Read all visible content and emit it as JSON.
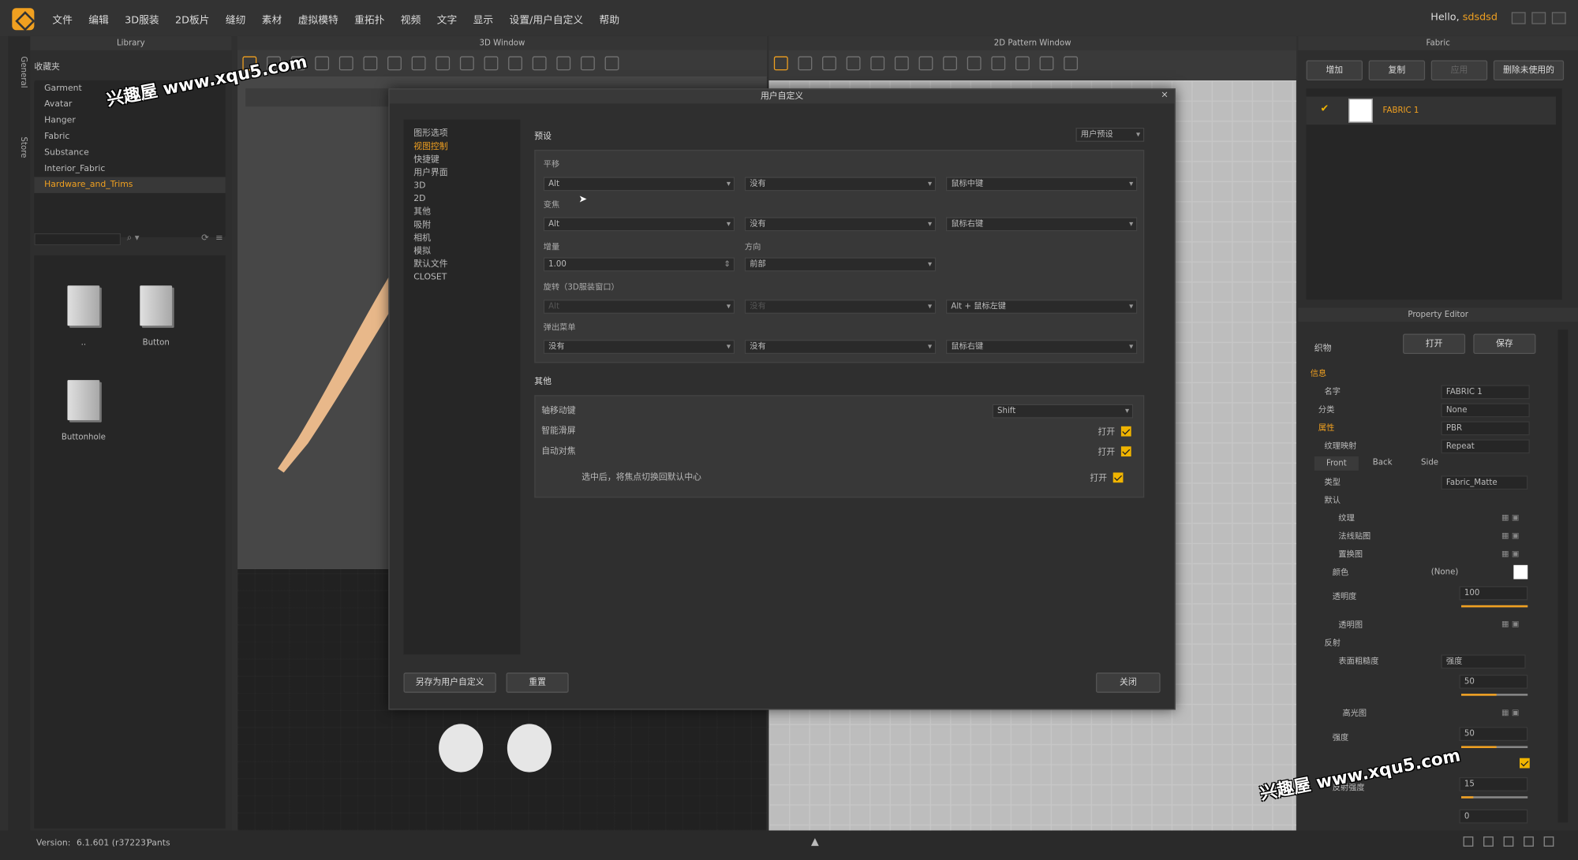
{
  "menubar": {
    "items": [
      "文件",
      "编辑",
      "3D服装",
      "2D板片",
      "缝纫",
      "素材",
      "虚拟模特",
      "重拓扑",
      "视频",
      "文字",
      "显示",
      "设置/用户自定义",
      "帮助"
    ],
    "greeting": "Hello,",
    "username": "sdsdsd"
  },
  "left_tabs": [
    "General",
    "Store"
  ],
  "library": {
    "title": "Library",
    "favorites_label": "收藏夹",
    "items": [
      "Garment",
      "Avatar",
      "Hanger",
      "Fabric",
      "Substance",
      "Interior_Fabric",
      "Hardware_and_Trims"
    ],
    "selected": "Hardware_and_Trims",
    "folders": [
      "..",
      "Button",
      "Buttonhole"
    ]
  },
  "window3d": {
    "title": "3D Window"
  },
  "window2d": {
    "title": "2D Pattern Window"
  },
  "fabric_panel": {
    "title": "Fabric",
    "buttons": [
      "增加",
      "复制",
      "应用",
      "删除未使用的"
    ],
    "fabric_name": "FABRIC 1"
  },
  "property_editor": {
    "title": "Property Editor",
    "object_label": "织物",
    "open_label": "打开",
    "save_label": "保存",
    "section_info": "信息",
    "name_label": "名字",
    "name_value": "FABRIC 1",
    "category_label": "分类",
    "category_value": "None",
    "attr_label": "属性",
    "attr_value": "PBR",
    "texture_map_label": "纹理映射",
    "texture_map_value": "Repeat",
    "sides": [
      "Front",
      "Back",
      "Side"
    ],
    "type_label": "类型",
    "type_value": "Fabric_Matte",
    "default_label": "默认",
    "texture_label": "纹理",
    "normal_label": "法线贴图",
    "displacement_label": "置换图",
    "color_label": "颜色",
    "color_value": "(None)",
    "opacity_label": "透明度",
    "opacity_value": "100",
    "opacity_map_label": "透明图",
    "reflection_label": "反射",
    "roughness_label": "表面粗糙度",
    "roughness_mode": "强度",
    "roughness_value": "50",
    "specular_label": "高光图",
    "intensity_label": "强度",
    "intensity_value": "50",
    "reflect_strength_label": "反射强度",
    "reflect_strength_value": "15",
    "last_value": "0"
  },
  "status": {
    "version_label": "Version:",
    "version": "6.1.601 (r37223)",
    "object": "Pants"
  },
  "dialog": {
    "title": "用户自定义",
    "close_x": "×",
    "nav": [
      "图形选项",
      "视图控制",
      "快捷键",
      "用户界面",
      "3D",
      "2D",
      "其他",
      "吸附",
      "相机",
      "模拟",
      "默认文件",
      "CLOSET"
    ],
    "nav_selected": "视图控制",
    "preset_label": "预设",
    "preset_value": "用户预设",
    "pan_label": "平移",
    "pan": [
      "Alt",
      "没有",
      "鼠标中键"
    ],
    "zoom_label": "变焦",
    "zoom": [
      "Alt",
      "没有",
      "鼠标右键"
    ],
    "increment_label": "增量",
    "direction_label": "方向",
    "increment_value": "1.00",
    "direction_value": "前部",
    "rotate_label": "旋转（3D服装窗口）",
    "rotate": [
      "Alt",
      "没有",
      "Alt + 鼠标左键"
    ],
    "popup_label": "弹出菜单",
    "popup": [
      "没有",
      "没有",
      "鼠标右键"
    ],
    "other_label": "其他",
    "axis_label": "轴移动键",
    "axis_value": "Shift",
    "smart_label": "智能滑屏",
    "smart_value": "打开",
    "autofocus_label": "自动对焦",
    "autofocus_value": "打开",
    "center_label": "选中后，将焦点切换回默认中心",
    "center_value": "打开",
    "save_as_btn": "另存为用户自定义",
    "reset_btn": "重置",
    "close_btn": "关闭"
  },
  "watermarks": [
    "兴趣屋 www.xqu5.com",
    "兴趣屋 www.xqu5.com"
  ],
  "accent_color": "#f0a020"
}
